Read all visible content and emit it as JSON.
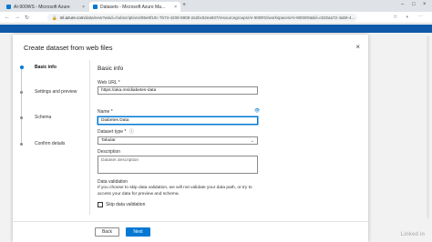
{
  "browser": {
    "tabs": [
      {
        "title": "AI-900WS - Microsoft Azure",
        "close": "×"
      },
      {
        "title": "Datasets - Microsoft Azure Ma...",
        "close": "×"
      }
    ],
    "new_tab": "+",
    "window_controls": {
      "minimize": "–",
      "maximize": "□",
      "close": "×"
    },
    "url_host": "ml.azure.com",
    "url_path": "/data/new?wsid=/subscriptions/95e5f10c-7b73-4208-8808-2a2bc62ea937/resourcegroups/AI-900RG/workspaces/AI-900WS&tid=c632aa72-4ab9-4..."
  },
  "dialog": {
    "title": "Create dataset from web files",
    "close_icon": "×",
    "steps": [
      {
        "label": "Basic info",
        "active": true
      },
      {
        "label": "Settings and preview",
        "active": false
      },
      {
        "label": "Schema",
        "active": false
      },
      {
        "label": "Confirm details",
        "active": false
      }
    ],
    "form": {
      "section_title": "Basic info",
      "web_url_label": "Web URL *",
      "web_url_value": "https://aka.ms/diabetes-data",
      "name_label": "Name *",
      "name_value": "Diabetes Data",
      "dataset_type_label": "Dataset type *",
      "dataset_type_value": "Tabular",
      "description_label": "Description",
      "description_placeholder": "Dataset description",
      "validation_title": "Data validation",
      "validation_text": "If you choose to skip data validation, we will not validate your data path, or try to access your data for preview and schema.",
      "skip_validation_label": "Skip data validation",
      "skip_validation_checked": false
    },
    "footer": {
      "back_label": "Back",
      "next_label": "Next"
    }
  },
  "watermark": "Linked in",
  "colors": {
    "accent": "#0078d4",
    "portal_bar": "#0f5aa8"
  }
}
